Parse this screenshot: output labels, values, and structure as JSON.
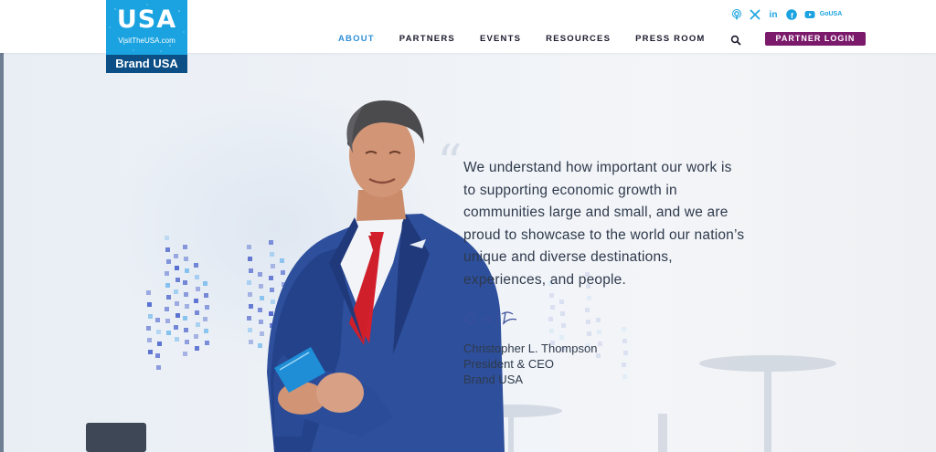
{
  "logo": {
    "wordmark": "USA",
    "url": "VisitTheUSA.com",
    "brand": "Brand USA"
  },
  "socials": [
    {
      "icon": "podcast-icon"
    },
    {
      "icon": "x-icon"
    },
    {
      "icon": "linkedin-icon",
      "label": "in"
    },
    {
      "icon": "facebook-icon",
      "label": "f"
    },
    {
      "icon": "youtube-icon"
    },
    {
      "icon": "gousa-icon",
      "line1": "Go",
      "line2": "USA"
    }
  ],
  "nav": {
    "items": [
      "ABOUT",
      "PARTNERS",
      "EVENTS",
      "RESOURCES",
      "PRESS ROOM"
    ],
    "active": "ABOUT",
    "partner_login": "PARTNER LOGIN"
  },
  "hero": {
    "quote": "We understand how important our work is to supporting economic growth in communities large and small, and we are proud to showcase to the world our nation’s unique and diverse destinations, experiences, and people.",
    "name": "Christopher L. Thompson",
    "title": "President & CEO",
    "org": "Brand USA"
  },
  "colors": {
    "accent_blue": "#1aa3e0",
    "brand_navy": "#0b4f86",
    "partner_purple": "#7b1a6b",
    "nav_active": "#2d8fd6"
  }
}
